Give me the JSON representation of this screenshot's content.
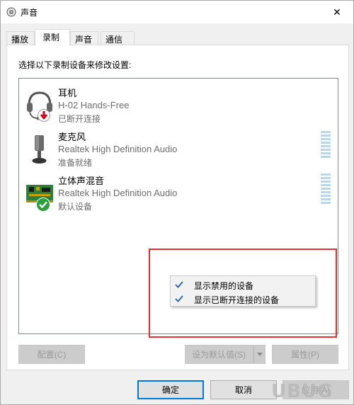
{
  "window": {
    "title": "声音",
    "close_glyph": "✕"
  },
  "tabs": [
    {
      "label": "播放"
    },
    {
      "label": "录制"
    },
    {
      "label": "声音"
    },
    {
      "label": "通信"
    }
  ],
  "active_tab": "录制",
  "instruction": "选择以下录制设备来修改设置:",
  "devices": [
    {
      "name": "耳机",
      "driver": "H-02 Hands-Free",
      "status": "已断开连接",
      "icon": "headset-icon",
      "badge": "disconnected-arrow-icon"
    },
    {
      "name": "麦克风",
      "driver": "Realtek High Definition Audio",
      "status": "准备就绪",
      "icon": "microphone-icon",
      "badge": ""
    },
    {
      "name": "立体声混音",
      "driver": "Realtek High Definition Audio",
      "status": "默认设备",
      "icon": "sound-card-icon",
      "badge": "default-check-icon"
    }
  ],
  "context_menu": {
    "items": [
      {
        "label": "显示禁用的设备",
        "checked": true
      },
      {
        "label": "显示已断开连接的设备",
        "checked": true
      }
    ]
  },
  "buttons": {
    "configure": "配置(C)",
    "set_default": "设为默认值(S)",
    "properties": "属性(P)",
    "ok": "确定",
    "cancel": "取消",
    "apply": "应用(A)"
  },
  "watermark": "UBUG",
  "colors": {
    "highlight_box": "#e03030",
    "default_button_border": "#0078d7",
    "default_badge": "#2b9f3a",
    "disconnected_badge": "#d0021b"
  }
}
